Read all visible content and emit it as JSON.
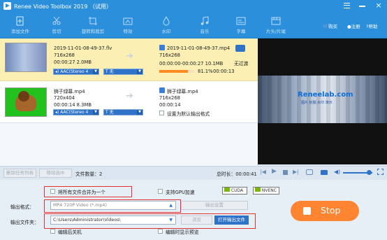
{
  "app": {
    "title": "Renee Video Toolbox 2019 （试用）"
  },
  "toolbar": {
    "items": [
      {
        "label": "添加文件",
        "icon": "add-file-icon"
      },
      {
        "label": "剪切",
        "icon": "scissors-icon"
      },
      {
        "label": "旋转和裁剪",
        "icon": "rotate-crop-icon"
      },
      {
        "label": "特效",
        "icon": "effects-icon"
      },
      {
        "label": "水印",
        "icon": "watermark-icon"
      },
      {
        "label": "音乐",
        "icon": "music-icon"
      },
      {
        "label": "字幕",
        "icon": "subtitle-icon"
      },
      {
        "label": "片头/片尾",
        "icon": "intro-outro-icon"
      }
    ],
    "buy": "购买",
    "register": "注册",
    "help": "帮助"
  },
  "files": [
    {
      "src_name": "2019-11-01-08-49-37.flv",
      "src_res": "716x268",
      "src_dur_size": "00:00:27  2.0MB",
      "audio": "AAC(Stereo 4",
      "subtitle": "无",
      "out_name": "2019-11-01-08-49-37.mp4",
      "out_res": "716x268",
      "out_time_size": "00:00:00-00:00:27  10.1MB",
      "progress_text": "81.1%",
      "progress": 0.811,
      "remaining": "00:00:13",
      "out_status": "无过渡"
    },
    {
      "src_name": "狮子绿幕.mp4",
      "src_res": "720x404",
      "src_dur_size": "00:00:14  8.3MB",
      "audio": "AAC(Stereo 4",
      "subtitle": "无",
      "out_name": "狮子绿幕.mp4",
      "out_res": "716x268",
      "out_time_size": "00:00:14",
      "default_label": "设置为默认输出格式"
    }
  ],
  "preview": {
    "watermark_line1": "Reneelab.com",
    "watermark_line2": "图片 标题 水印 演示"
  },
  "controls": {
    "clear": "删除任务列表",
    "remove": "移除选中",
    "count_label": "文件数量：",
    "count": "2",
    "total_label": "总时长：",
    "total": "00:00:41"
  },
  "options": {
    "merge": "将所有文件合并为一个",
    "gpu": "支持GPU加速",
    "cuda": "CUDA",
    "nvenc": "NVENC",
    "format_label": "输出格式：",
    "format_value": "MP4 720P Video (*.mp4)",
    "output_settings": "输出设置",
    "folder_label": "输出文件夹：",
    "folder_value": "C:\\Users\\Administrator\\Videos\\",
    "browse": "浏览",
    "open_folder": "打开输出文件",
    "shutdown": "编辑后关机",
    "preview_on_edit": "编辑时显示预览",
    "stop": "Stop"
  }
}
